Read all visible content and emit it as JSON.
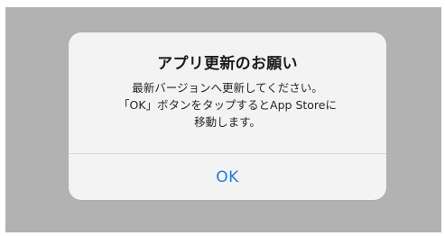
{
  "alert": {
    "title": "アプリ更新のお願い",
    "message_lines": [
      "最新バージョンへ更新してください。",
      "「OK」ボタンをタップするとApp Storeに",
      "移動します。"
    ],
    "button_label": "OK"
  },
  "colors": {
    "backdrop": "#b2b2b2",
    "alert_background": "#f3f3f3",
    "button_text": "#1f7ae0"
  }
}
